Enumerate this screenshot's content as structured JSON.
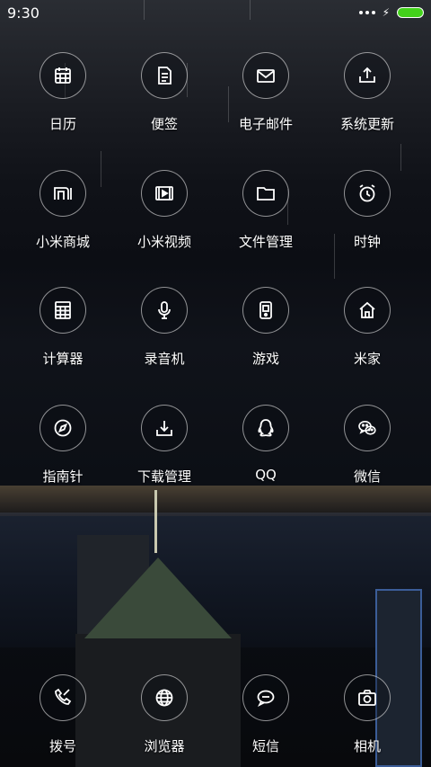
{
  "status_bar": {
    "time": "9:30"
  },
  "apps": [
    {
      "label": "日历",
      "icon": "calendar-icon"
    },
    {
      "label": "便签",
      "icon": "notes-icon"
    },
    {
      "label": "电子邮件",
      "icon": "email-icon"
    },
    {
      "label": "系统更新",
      "icon": "update-icon"
    },
    {
      "label": "小米商城",
      "icon": "mi-store-icon"
    },
    {
      "label": "小米视频",
      "icon": "video-icon"
    },
    {
      "label": "文件管理",
      "icon": "folder-icon"
    },
    {
      "label": "时钟",
      "icon": "clock-icon"
    },
    {
      "label": "计算器",
      "icon": "calculator-icon"
    },
    {
      "label": "录音机",
      "icon": "microphone-icon"
    },
    {
      "label": "游戏",
      "icon": "gamepad-icon"
    },
    {
      "label": "米家",
      "icon": "home-icon"
    },
    {
      "label": "指南针",
      "icon": "compass-icon"
    },
    {
      "label": "下载管理",
      "icon": "download-icon"
    },
    {
      "label": "QQ",
      "icon": "qq-icon"
    },
    {
      "label": "微信",
      "icon": "wechat-icon"
    }
  ],
  "dock": [
    {
      "label": "拨号",
      "icon": "phone-icon"
    },
    {
      "label": "浏览器",
      "icon": "browser-icon"
    },
    {
      "label": "短信",
      "icon": "message-icon"
    },
    {
      "label": "相机",
      "icon": "camera-icon"
    }
  ],
  "colors": {
    "battery": "#43d21b"
  }
}
